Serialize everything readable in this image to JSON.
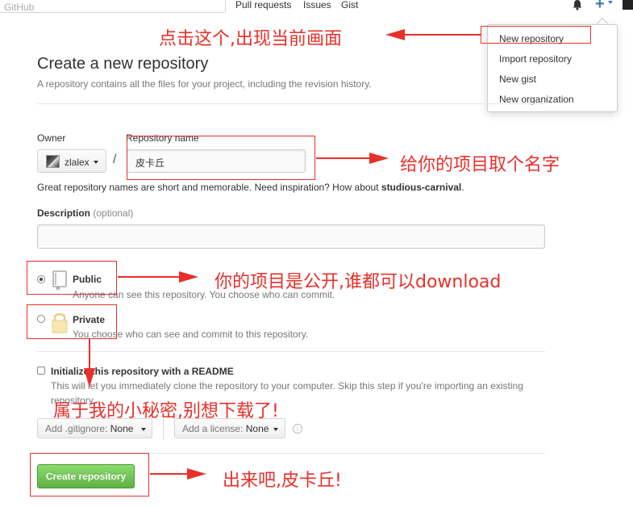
{
  "topbar": {
    "search_placeholder": "GitHub",
    "nav": [
      "Pull requests",
      "Issues",
      "Gist"
    ],
    "plus_label": "+"
  },
  "dropdown": {
    "items": [
      "New repository",
      "Import repository",
      "New gist",
      "New organization"
    ]
  },
  "page": {
    "title": "Create a new repository",
    "subtitle": "A repository contains all the files for your project, including the revision history."
  },
  "form": {
    "owner_label": "Owner",
    "owner_value": "zlalex",
    "slash": "/",
    "repo_name_label": "Repository name",
    "repo_name_value": "皮卡丘",
    "hint_prefix": "Great repository names are short and memorable. Need inspiration? How about ",
    "hint_suggestion": "studious-carnival",
    "hint_suffix": ".",
    "description_label": "Description",
    "description_optional": "(optional)",
    "description_value": "",
    "public_label": "Public",
    "public_desc": "Anyone can see this repository. You choose who can commit.",
    "private_label": "Private",
    "private_desc": "You choose who can see and commit to this repository.",
    "readme_label": "Initialize this repository with a README",
    "readme_desc_1": "This will let you immediately clone the repository to your computer. Skip this step if you're importing an existing",
    "readme_desc_2": "repository.",
    "gitignore_label": "Add .gitignore:",
    "gitignore_value": "None",
    "license_label": "Add a license:",
    "license_value": "None",
    "info_icon_glyph": "i",
    "create_button": "Create repository"
  },
  "annotations": {
    "note_dropdown": "点击这个,出现当前画面",
    "note_name": "给你的项目取个名字",
    "note_public": "你的项目是公开,谁都可以download",
    "note_private": "属于我的小秘密,别想下载了!",
    "note_create": "出来吧,皮卡丘!",
    "color": "#e8302b"
  },
  "colors": {
    "accent": "#4078c0",
    "create_green": "#60b044",
    "annotation_red": "#e8302b"
  }
}
